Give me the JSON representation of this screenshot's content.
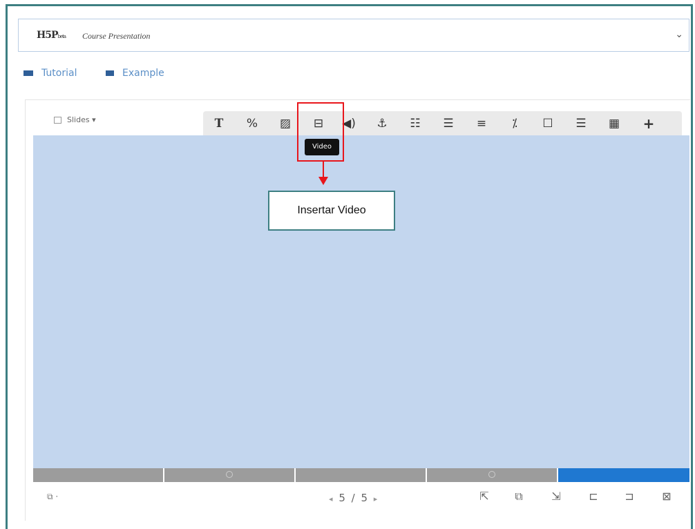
{
  "library_selector": {
    "logo": "H5P",
    "logo_small": "beta",
    "name": "Course Presentation",
    "chevron_icon": "chevron-down-icon"
  },
  "links": {
    "tutorial": "Tutorial",
    "example": "Example"
  },
  "editor": {
    "slides_dropdown": "Slides",
    "tools": [
      {
        "name": "text-tool",
        "icon": "text-icon",
        "glyph": "T"
      },
      {
        "name": "link-tool",
        "icon": "link-icon",
        "glyph": "%"
      },
      {
        "name": "image-tool",
        "icon": "image-icon",
        "glyph": "▨"
      },
      {
        "name": "video-tool",
        "icon": "video-icon",
        "glyph": "⊟"
      },
      {
        "name": "audio-tool",
        "icon": "audio-icon",
        "glyph": "◀)"
      },
      {
        "name": "anchor-tool",
        "icon": "anchor-icon",
        "glyph": "⚓"
      },
      {
        "name": "fill-blanks-tool",
        "icon": "fill-blanks-icon",
        "glyph": "☷"
      },
      {
        "name": "single-choice-tool",
        "icon": "single-choice-icon",
        "glyph": "☰"
      },
      {
        "name": "multiple-choice-tool",
        "icon": "multiple-choice-icon",
        "glyph": "≡"
      },
      {
        "name": "true-false-tool",
        "icon": "true-false-icon",
        "glyph": "⁒"
      },
      {
        "name": "drag-text-tool",
        "icon": "drag-text-icon",
        "glyph": "☐"
      },
      {
        "name": "summary-tool",
        "icon": "summary-icon",
        "glyph": "☰"
      },
      {
        "name": "table-tool",
        "icon": "table-icon",
        "glyph": "▦"
      },
      {
        "name": "more-tool",
        "icon": "plus-icon",
        "glyph": "+"
      }
    ],
    "tooltip": "Video"
  },
  "annotation": {
    "callout": "Insertar Video",
    "color": "#e8151b"
  },
  "navigation": {
    "current": 5,
    "total": 5,
    "label": "5 / 5"
  },
  "slide_tools": [
    {
      "name": "sort-left-tool",
      "icon": "sort-left-icon",
      "glyph": "⇱"
    },
    {
      "name": "clone-slide-tool",
      "icon": "clone-icon",
      "glyph": "⧉"
    },
    {
      "name": "background-tool",
      "icon": "background-icon",
      "glyph": "⇲"
    },
    {
      "name": "add-before-tool",
      "icon": "add-before-icon",
      "glyph": "⊏"
    },
    {
      "name": "add-after-tool",
      "icon": "add-after-icon",
      "glyph": "⊐"
    },
    {
      "name": "delete-slide-tool",
      "icon": "delete-icon",
      "glyph": "⊠"
    }
  ],
  "colors": {
    "canvas": "#c3d6ee",
    "progress_active": "#1f78d1",
    "progress_inactive": "#9c9c9c"
  }
}
